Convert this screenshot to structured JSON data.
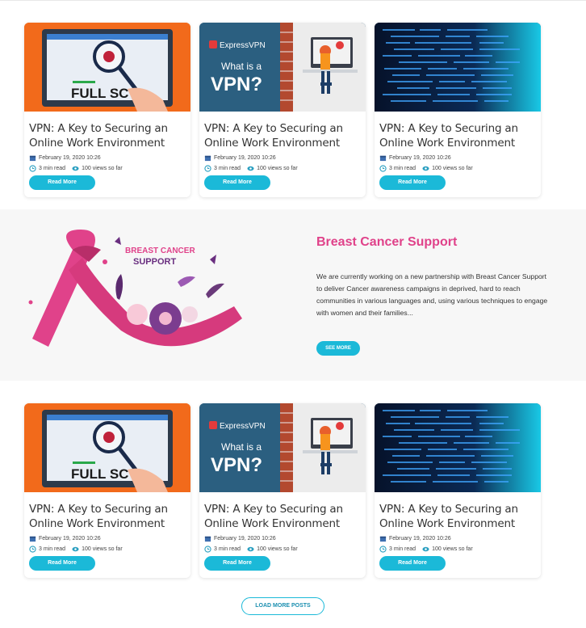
{
  "posts_row1": [
    {
      "title": "VPN: A Key to Securing an Online Work Environment",
      "date": "February 19, 2020 10:26",
      "read_time": "3 min read",
      "views": "100 views so far",
      "button": "Read More",
      "thumb": "scan"
    },
    {
      "title": "VPN: A Key to Securing an Online Work Environment",
      "date": "February 19, 2020 10:26",
      "read_time": "3 min read",
      "views": "100 views so far",
      "button": "Read More",
      "thumb": "vpn"
    },
    {
      "title": "VPN: A Key to Securing an Online Work Environment",
      "date": "February 19, 2020 10:26",
      "read_time": "3 min read",
      "views": "100 views so far",
      "button": "Read More",
      "thumb": "code"
    }
  ],
  "posts_row2": [
    {
      "title": "VPN: A Key to Securing an Online Work Environment",
      "date": "February 19, 2020 10:26",
      "read_time": "3 min read",
      "views": "100 views so far",
      "button": "Read More",
      "thumb": "scan"
    },
    {
      "title": "VPN: A Key to Securing an Online Work Environment",
      "date": "February 19, 2020 10:26",
      "read_time": "3 min read",
      "views": "100 views so far",
      "button": "Read More",
      "thumb": "vpn"
    },
    {
      "title": "VPN: A Key to Securing an Online Work Environment",
      "date": "February 19, 2020 10:26",
      "read_time": "3 min read",
      "views": "100 views so far",
      "button": "Read More",
      "thumb": "code"
    }
  ],
  "thumb_text": {
    "scan_label": "FULL SC",
    "vpn_brand": "ExpressVPN",
    "vpn_q1": "What is a",
    "vpn_q2": "VPN?"
  },
  "feature": {
    "image_text_line1": "BREAST CANCER",
    "image_text_line2": "SUPPORT",
    "title": "Breast Cancer Support",
    "text": "We are currently working on a new partnership with Breast Cancer Support to deliver Cancer awareness campaigns in deprived, hard to reach communities in various languages and, using various techniques to engage with women and their families...",
    "button": "SEE MORE"
  },
  "load_more": "LOAD MORE POSTS",
  "colors": {
    "accent": "#1bb9d8",
    "pink": "#e0428a",
    "orange": "#f26a1b"
  },
  "icons": {
    "date": "calendar-icon",
    "read": "clock-icon",
    "views": "eye-icon"
  }
}
